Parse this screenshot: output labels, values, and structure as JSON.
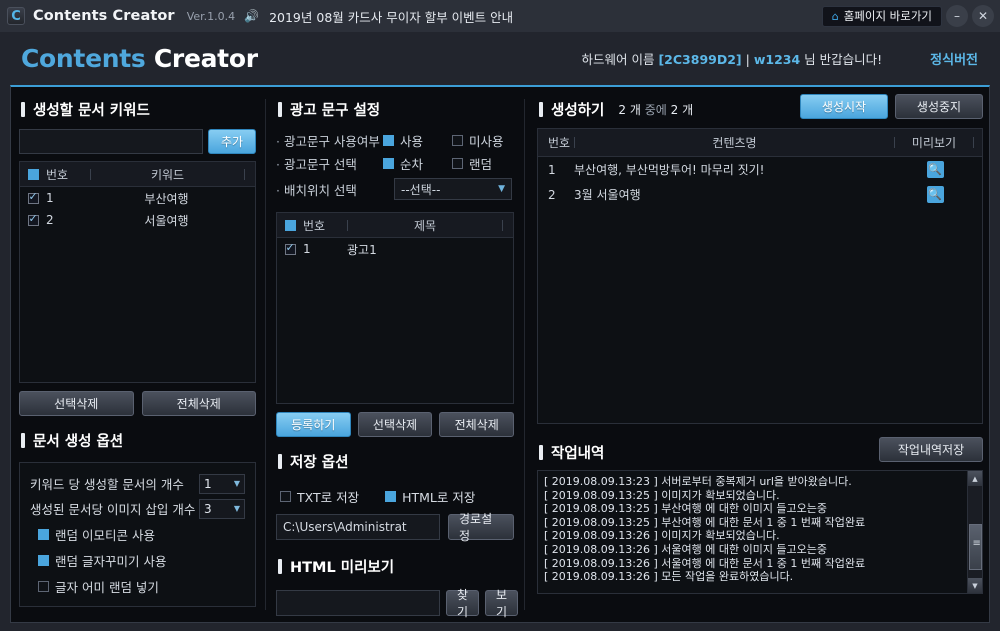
{
  "titlebar": {
    "app_icon": "app-logo-icon",
    "title": "Contents Creator",
    "version": "Ver.1.0.4",
    "speaker_icon": "speaker-icon",
    "notice": "2019년 08월 카드사 무이자 할부 이벤트 안내",
    "home_icon": "home-icon",
    "home_label": "홈페이지 바로가기",
    "minimize": "–",
    "close": "✕"
  },
  "header": {
    "brand_1": "Contents",
    "brand_2": "Creator",
    "hardware_label": "하드웨어 이름",
    "hardware_id": "[2C3899D2]",
    "separator": "|",
    "user": "w1234",
    "greeting": "님 반갑습니다!",
    "version_tag": "정식버전"
  },
  "keywords_panel": {
    "title": "생성할 문서 키워드",
    "input_value": "",
    "add_label": "추가",
    "columns": {
      "select_all": "",
      "no": "번호",
      "keyword": "키워드"
    },
    "rows": [
      {
        "checked": true,
        "no": "1",
        "keyword": "부산여행"
      },
      {
        "checked": true,
        "no": "2",
        "keyword": "서울여행"
      }
    ],
    "delete_selected": "선택삭제",
    "delete_all": "전체삭제"
  },
  "doc_options": {
    "title": "문서 생성 옵션",
    "count_per_keyword_label": "키워드 당 생성할 문서의 개수",
    "count_per_keyword_value": "1",
    "images_per_doc_label": "생성된 문서당 이미지 삽입 개수",
    "images_per_doc_value": "3",
    "opt_emoticon": "랜덤 이모티콘 사용",
    "opt_emoticon_checked": true,
    "opt_decor": "랜덤 글자꾸미기 사용",
    "opt_decor_checked": true,
    "opt_ending": "글자 어미 랜덤 넣기",
    "opt_ending_checked": false
  },
  "ad_panel": {
    "title": "광고 문구 설정",
    "use_label": "광고문구 사용여부",
    "use_on": "사용",
    "use_off": "미사용",
    "use_on_checked": true,
    "use_off_checked": false,
    "select_label": "광고문구 선택",
    "select_seq": "순차",
    "select_random": "랜덤",
    "select_seq_checked": true,
    "select_random_checked": false,
    "position_label": "배치위치 선택",
    "position_value": "--선택--",
    "columns": {
      "no": "번호",
      "title": "제목"
    },
    "rows": [
      {
        "checked": true,
        "no": "1",
        "title": "광고1"
      }
    ],
    "register": "등록하기",
    "delete_selected": "선택삭제",
    "delete_all": "전체삭제"
  },
  "save_options": {
    "title": "저장 옵션",
    "txt_label": "TXT로 저장",
    "txt_checked": false,
    "html_label": "HTML로 저장",
    "html_checked": true,
    "path_value": "C:\\Users\\Administrat",
    "path_button": "경로설정"
  },
  "html_preview": {
    "title": "HTML 미리보기",
    "input_value": "",
    "find_label": "찾기",
    "view_label": "보기"
  },
  "generate_panel": {
    "title": "생성하기",
    "count_done": "2 개",
    "count_mid": "중에",
    "count_total": "2 개",
    "start_label": "생성시작",
    "stop_label": "생성중지",
    "columns": {
      "no": "번호",
      "name": "컨텐츠명",
      "preview": "미리보기"
    },
    "rows": [
      {
        "no": "1",
        "name": "부산여행, 부산먹방투어! 마무리 짓기!",
        "preview_icon": "magnifier-icon"
      },
      {
        "no": "2",
        "name": "3월 서울여행",
        "preview_icon": "magnifier-icon"
      }
    ]
  },
  "log_panel": {
    "title": "작업내역",
    "save_label": "작업내역저장",
    "lines": [
      "[ 2019.08.09.13:23 ] 서버로부터 중복제거 url을 받아왔습니다.",
      "[ 2019.08.09.13:25 ] 이미지가 확보되었습니다.",
      "[ 2019.08.09.13:25 ] 부산여행 에 대한 이미지 들고오는중",
      "[ 2019.08.09.13:25 ] 부산여행 에 대한 문서 1 중 1 번째 작업완료",
      "[ 2019.08.09.13:26 ] 이미지가 확보되었습니다.",
      "[ 2019.08.09.13:26 ] 서울여행 에 대한 이미지 들고오는중",
      "[ 2019.08.09.13:26 ] 서울여행 에 대한 문서 1 중 1 번째 작업완료",
      "[ 2019.08.09.13:26 ] 모든 작업을 완료하였습니다."
    ],
    "scroll_up": "▲",
    "scroll_down": "▼"
  },
  "colors": {
    "accent": "#4aa5dd",
    "window_bg": "#22252d",
    "content_bg": "#0a0c10",
    "titlebar_bg": "#2c3039"
  }
}
